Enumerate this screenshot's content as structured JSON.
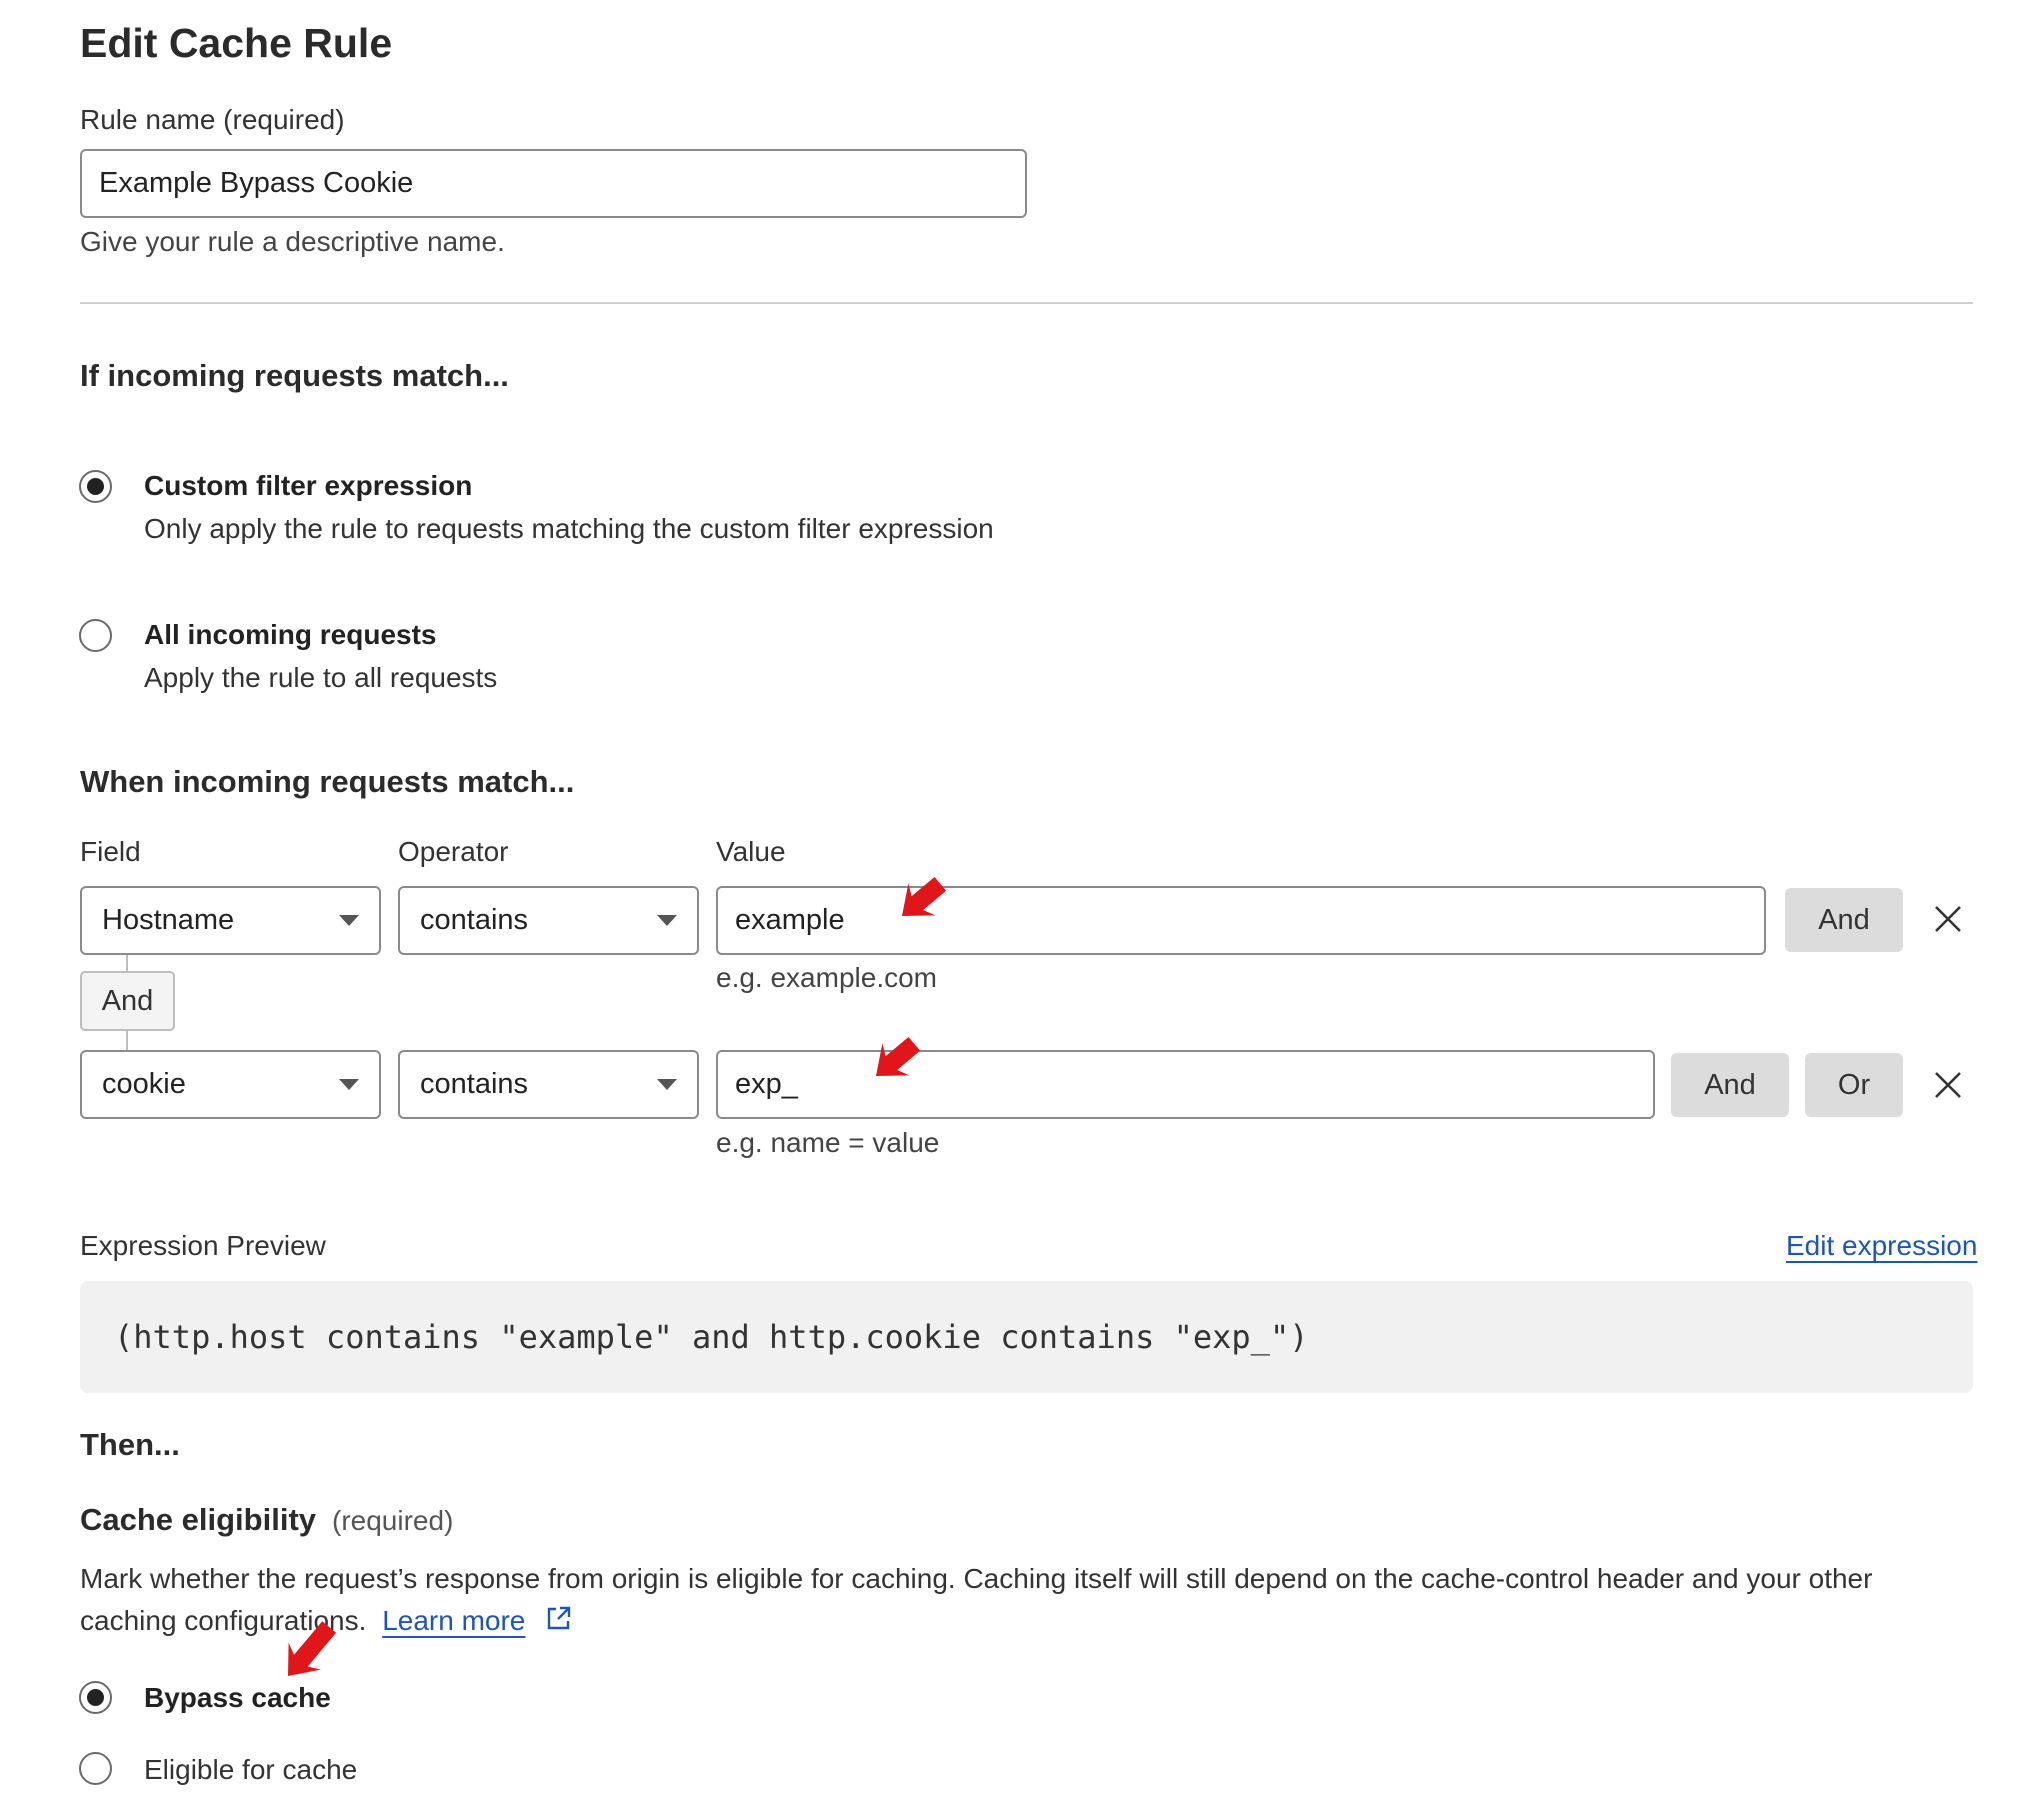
{
  "page": {
    "title": "Edit Cache Rule"
  },
  "rule_name": {
    "label": "Rule name (required)",
    "value": "Example Bypass Cookie",
    "help": "Give your rule a descriptive name."
  },
  "match_section": {
    "heading": "If incoming requests match...",
    "options": [
      {
        "title": "Custom filter expression",
        "desc": "Only apply the rule to requests matching the custom filter expression",
        "selected": true
      },
      {
        "title": "All incoming requests",
        "desc": "Apply the rule to all requests",
        "selected": false
      }
    ]
  },
  "expression_builder": {
    "heading": "When incoming requests match...",
    "col_field": "Field",
    "col_operator": "Operator",
    "col_value": "Value",
    "connector": "And",
    "rows": [
      {
        "field": "Hostname",
        "operator": "contains",
        "value": "example",
        "hint": "e.g. example.com",
        "and_label": "And"
      },
      {
        "field": "cookie",
        "operator": "contains",
        "value": "exp_",
        "hint": "e.g. name = value",
        "and_label": "And",
        "or_label": "Or"
      }
    ]
  },
  "preview": {
    "label": "Expression Preview",
    "edit_link": "Edit expression",
    "expression": "(http.host contains \"example\" and http.cookie contains \"exp_\")"
  },
  "then": {
    "heading": "Then...",
    "cache_eligibility": {
      "title": "Cache eligibility",
      "required": "(required)",
      "desc_line1": "Mark whether the request’s response from origin is eligible for caching. Caching itself will still depend on the cache-control header and your other",
      "desc_line2": "caching configurations.",
      "learn_more": "Learn more",
      "options": [
        {
          "label": "Bypass cache",
          "selected": true
        },
        {
          "label": "Eligible for cache",
          "selected": false
        }
      ]
    }
  },
  "colors": {
    "link": "#1f55b5",
    "annotation_arrow": "#e0161b",
    "button_grey": "#dcdcdc"
  }
}
